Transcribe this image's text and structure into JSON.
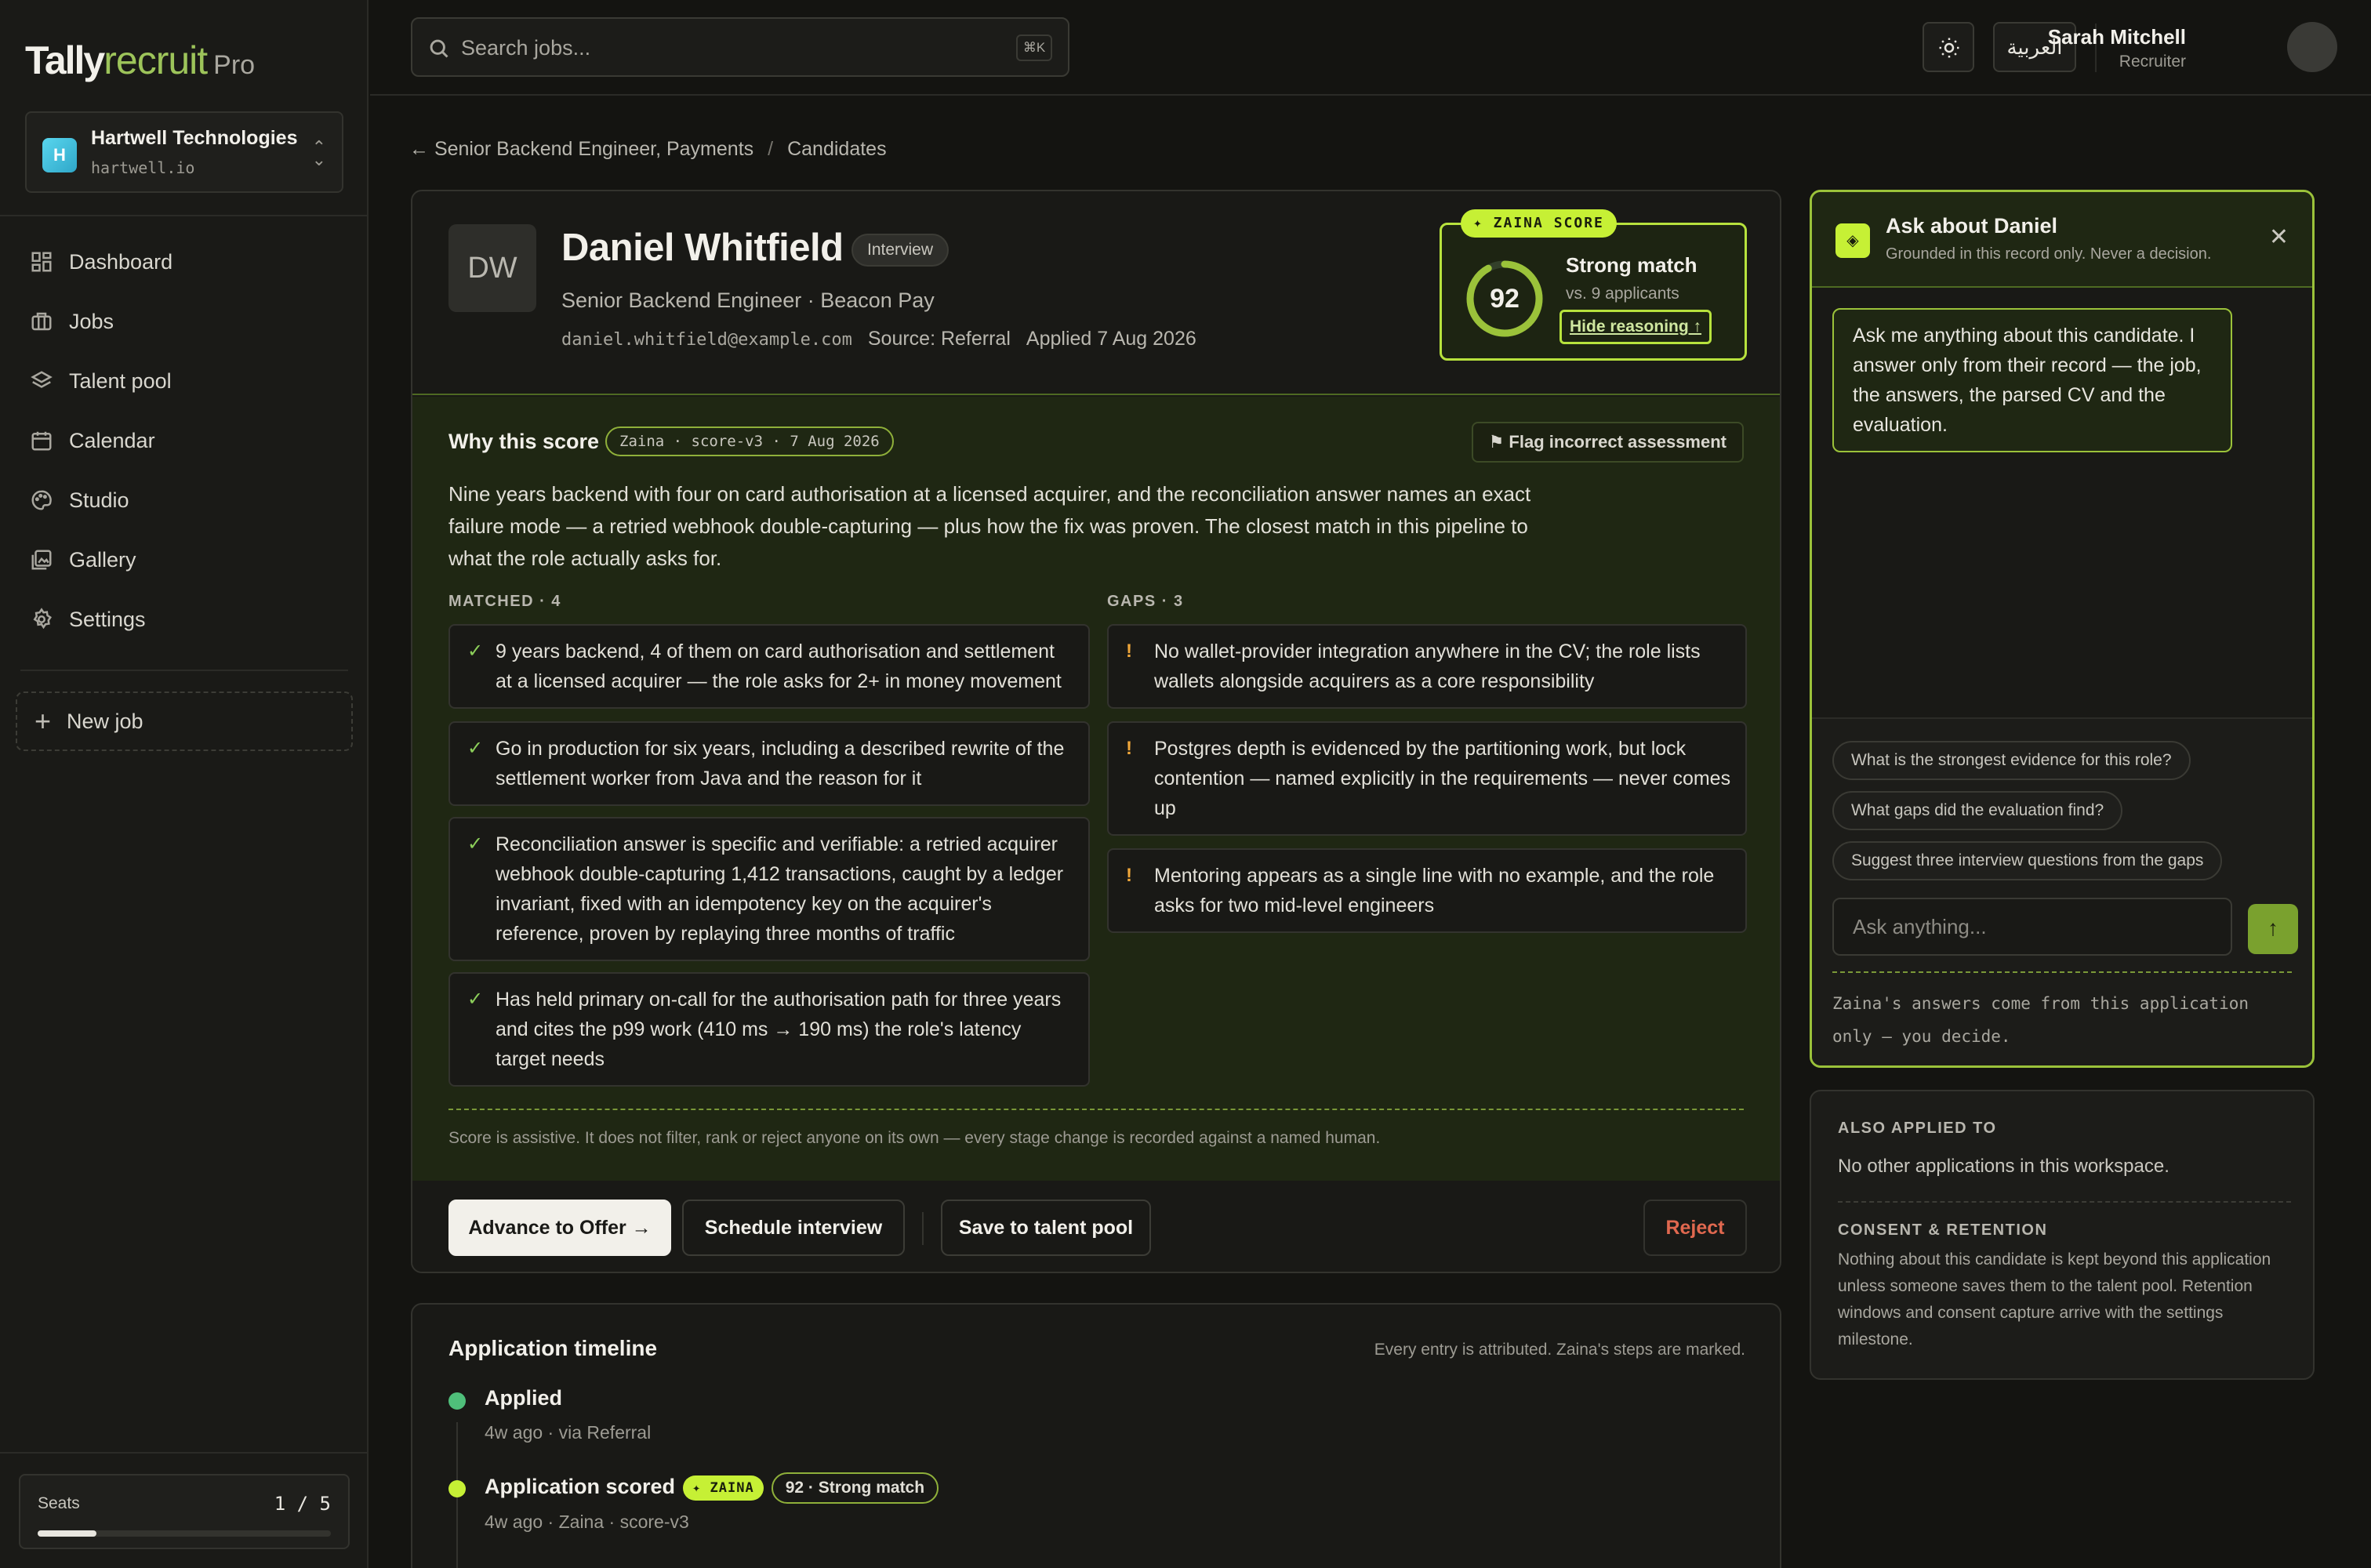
{
  "app": {
    "brand_main": "Tally",
    "brand_accent": "recruit",
    "brand_tier": "Pro"
  },
  "org": {
    "initial": "H",
    "name": "Hartwell Technologies",
    "domain": "hartwell.io"
  },
  "nav": [
    {
      "label": "Dashboard",
      "icon": "dashboard-icon"
    },
    {
      "label": "Jobs",
      "icon": "briefcase-icon"
    },
    {
      "label": "Talent pool",
      "icon": "layers-icon"
    },
    {
      "label": "Calendar",
      "icon": "calendar-icon"
    },
    {
      "label": "Studio",
      "icon": "palette-icon"
    },
    {
      "label": "Gallery",
      "icon": "gallery-icon"
    },
    {
      "label": "Settings",
      "icon": "gear-icon"
    }
  ],
  "new_job": {
    "plus": "+",
    "label": "New job"
  },
  "seats": {
    "label": "Seats",
    "value": "1 / 5",
    "fraction": 0.2
  },
  "search": {
    "placeholder": "Search jobs...",
    "shortcut": "⌘K"
  },
  "topbar": {
    "lang": "العربية",
    "user_name": "Sarah Mitchell",
    "user_role": "Recruiter"
  },
  "breadcrumb": {
    "back": "← Senior Backend Engineer, Payments",
    "sep": "/",
    "current": "Candidates"
  },
  "candidate": {
    "initials": "DW",
    "name": "Daniel Whitfield",
    "stage": "Interview",
    "role": "Senior Backend Engineer · Beacon Pay",
    "email": "daniel.whitfield@example.com",
    "source": "Source: Referral",
    "applied": "Applied 7 Aug 2026"
  },
  "score": {
    "badge": "✦ ZAINA SCORE",
    "value": "92",
    "value_fraction": 0.92,
    "label": "Strong match",
    "compare": "vs. 9 applicants",
    "toggle": "Hide reasoning ↑"
  },
  "why": {
    "title": "Why this score",
    "version": "Zaina · score-v3 · 7 Aug 2026",
    "flag": "⚑ Flag incorrect assessment",
    "summary": "Nine years backend with four on card authorisation at a licensed acquirer, and the reconciliation answer names an exact failure mode — a retried webhook double-capturing — plus how the fix was proven. The closest match in this pipeline to what the role actually asks for.",
    "matched_header": "MATCHED · 4",
    "gaps_header": "GAPS · 3",
    "check": "✓",
    "bang": "!",
    "matched": [
      "9 years backend, 4 of them on card authorisation and settlement at a licensed acquirer — the role asks for 2+ in money movement",
      "Go in production for six years, including a described rewrite of the settlement worker from Java and the reason for it",
      "Reconciliation answer is specific and verifiable: a retried acquirer webhook double-capturing 1,412 transactions, caught by a ledger invariant, fixed with an idempotency key on the acquirer's reference, proven by replaying three months of traffic",
      "Has held primary on-call for the authorisation path for three years and cites the p99 work (410 ms → 190 ms) the role's latency target needs"
    ],
    "gaps": [
      "No wallet-provider integration anywhere in the CV; the role lists wallets alongside acquirers as a core responsibility",
      "Postgres depth is evidenced by the partitioning work, but lock contention — named explicitly in the requirements — never comes up",
      "Mentoring appears as a single line with no example, and the role asks for two mid-level engineers"
    ],
    "footnote": "Score is assistive. It does not filter, rank or reject anyone on its own — every stage change is recorded against a named human."
  },
  "actions": {
    "advance": "Advance to Offer →",
    "schedule": "Schedule interview",
    "save": "Save to talent pool",
    "reject": "Reject"
  },
  "timeline": {
    "title": "Application timeline",
    "note": "Every entry is attributed. Zaina's steps are marked.",
    "events": [
      {
        "title": "Applied",
        "sub": "4w ago · via Referral"
      },
      {
        "title": "Application scored",
        "zaina": "✦ ZAINA",
        "score_pill": "92 · Strong match",
        "sub": "4w ago · Zaina · score-v3"
      }
    ]
  },
  "ask": {
    "icon": "◈",
    "title": "Ask about Daniel",
    "subtitle": "Grounded in this record only. Never a decision.",
    "close": "✕",
    "greeting": "Ask me anything about this candidate. I answer only from their record — the job, the answers, the parsed CV and the evaluation.",
    "suggestions": [
      "What is the strongest evidence for this role?",
      "What gaps did the evaluation find?",
      "Suggest three interview questions from the gaps"
    ],
    "placeholder": "Ask anything...",
    "send": "↑",
    "note": "Zaina's answers come from this application only — you decide."
  },
  "also": {
    "h1": "ALSO APPLIED TO",
    "t1": "No other applications in this workspace.",
    "h2": "CONSENT & RETENTION",
    "t2": "Nothing about this candidate is kept beyond this application unless someone saves them to the talent pool. Retention windows and consent capture arrive with the settings milestone."
  },
  "colors": {
    "accent": "#c6f035",
    "match_ok": "#8ccf5a",
    "gap": "#f0a73a",
    "danger": "#e0684f",
    "timeline_green": "#4fbf7a"
  }
}
